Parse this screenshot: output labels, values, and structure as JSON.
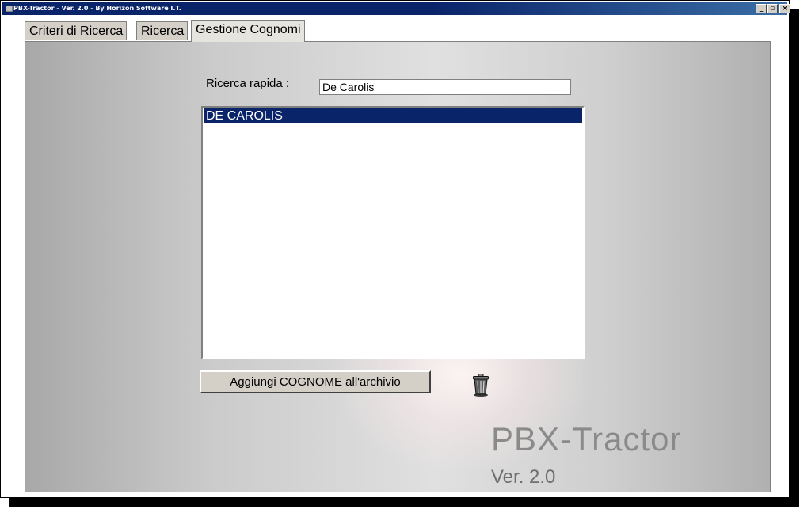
{
  "window": {
    "title": "PBX-Tractor - Ver. 2.0 - By Horizon Software I.T.",
    "controls": {
      "minimize": "_",
      "maximize": "▫",
      "close": "×"
    }
  },
  "tabs": [
    {
      "label": "Criteri di Ricerca",
      "active": false
    },
    {
      "label": "Ricerca",
      "active": false
    },
    {
      "label": "Gestione Cognomi",
      "active": true
    }
  ],
  "search": {
    "label": "Ricerca rapida :",
    "value": "De Carolis"
  },
  "list": {
    "items": [
      "DE CAROLIS"
    ],
    "selected": 0
  },
  "add_button": {
    "label": "Aggiungi COGNOME all'archivio"
  },
  "trash": {
    "icon": "trash-icon"
  },
  "branding": {
    "name": "PBX-Tractor",
    "version": "Ver. 2.0"
  },
  "colors": {
    "titlebar": "#0a246a",
    "selection": "#0a246a"
  }
}
